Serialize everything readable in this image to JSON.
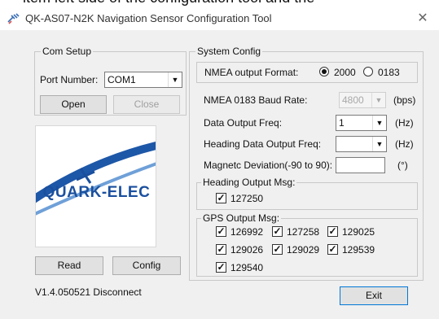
{
  "background_text": "item left side of the configuration tool and the",
  "window": {
    "title": "QK-AS07-N2K Navigation Sensor Configuration Tool",
    "close_glyph": "✕"
  },
  "com_setup": {
    "title": "Com Setup",
    "port_label": "Port Number:",
    "port_value": "COM1",
    "open_label": "Open",
    "close_label": "Close"
  },
  "logo": {
    "text": "QUARK-ELEC",
    "color": "#1a4f9e"
  },
  "actions": {
    "read_label": "Read",
    "config_label": "Config",
    "exit_label": "Exit"
  },
  "status": {
    "text": "V1.4.050521 Disconnect"
  },
  "system_config": {
    "title": "System Config",
    "nmea_format_label": "NMEA output Format:",
    "format_options": [
      "2000",
      "0183"
    ],
    "format_selected": "2000",
    "baud_label": "NMEA 0183 Baud Rate:",
    "baud_value": "4800",
    "baud_unit": "(bps)",
    "data_freq_label": "Data Output Freq:",
    "data_freq_value": "1",
    "data_freq_unit": "(Hz)",
    "heading_freq_label": "Heading Data Output Freq:",
    "heading_freq_value": "",
    "heading_freq_unit": "(Hz)",
    "deviation_label": "Magnetc Deviation(-90 to 90):",
    "deviation_value": "",
    "deviation_unit": "(°)",
    "heading_msg": {
      "title": "Heading Output Msg:",
      "items": [
        {
          "label": "127250",
          "checked": true
        }
      ]
    },
    "gps_msg": {
      "title": "GPS Output Msg:",
      "items": [
        {
          "label": "126992",
          "checked": true
        },
        {
          "label": "127258",
          "checked": true
        },
        {
          "label": "129025",
          "checked": true
        },
        {
          "label": "129026",
          "checked": true
        },
        {
          "label": "129029",
          "checked": true
        },
        {
          "label": "129539",
          "checked": true
        },
        {
          "label": "129540",
          "checked": true
        }
      ]
    }
  }
}
